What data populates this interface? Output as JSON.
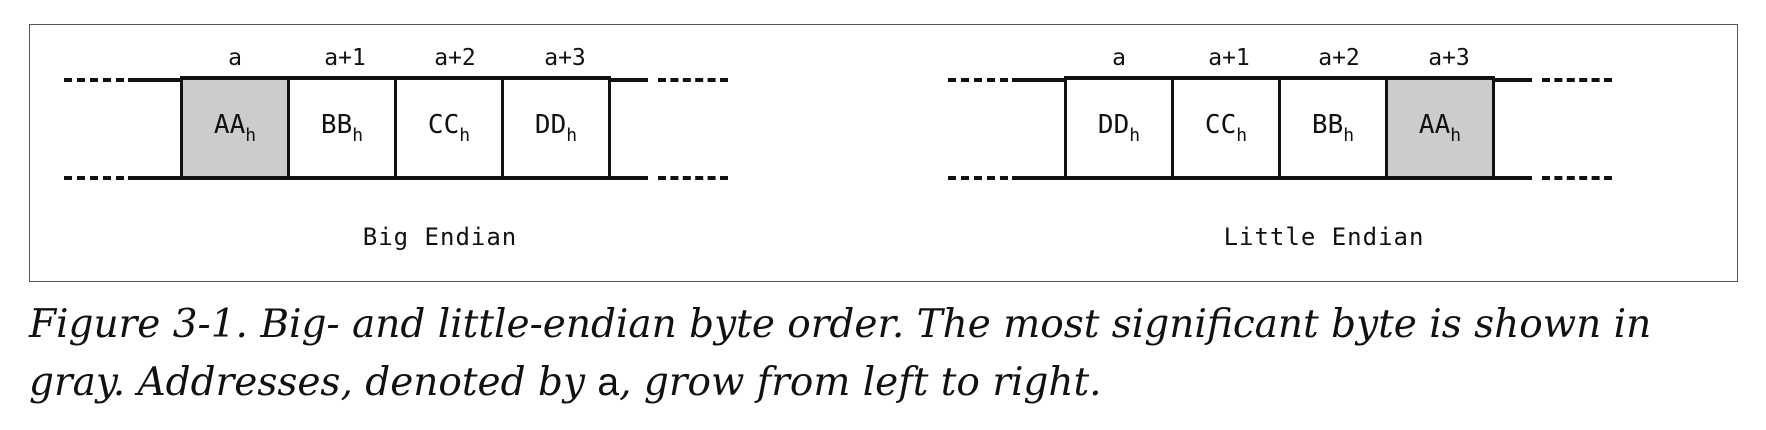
{
  "big_endian": {
    "addresses": [
      "a",
      "a+1",
      "a+2",
      "a+3"
    ],
    "bytes": [
      {
        "value": "AA",
        "sub": "h",
        "msb": true
      },
      {
        "value": "BB",
        "sub": "h",
        "msb": false
      },
      {
        "value": "CC",
        "sub": "h",
        "msb": false
      },
      {
        "value": "DD",
        "sub": "h",
        "msb": false
      }
    ],
    "label": "Big Endian"
  },
  "little_endian": {
    "addresses": [
      "a",
      "a+1",
      "a+2",
      "a+3"
    ],
    "bytes": [
      {
        "value": "DD",
        "sub": "h",
        "msb": false
      },
      {
        "value": "CC",
        "sub": "h",
        "msb": false
      },
      {
        "value": "BB",
        "sub": "h",
        "msb": false
      },
      {
        "value": "AA",
        "sub": "h",
        "msb": true
      }
    ],
    "label": "Little Endian"
  },
  "colors": {
    "msb_fill": "#cccccc",
    "line": "#111111"
  },
  "caption": {
    "part1": "Figure 3-1. Big- and little-endian byte order. The most significant byte is shown in gray. Addresses, denoted by ",
    "var": "a",
    "part2": ", grow from left to right."
  }
}
